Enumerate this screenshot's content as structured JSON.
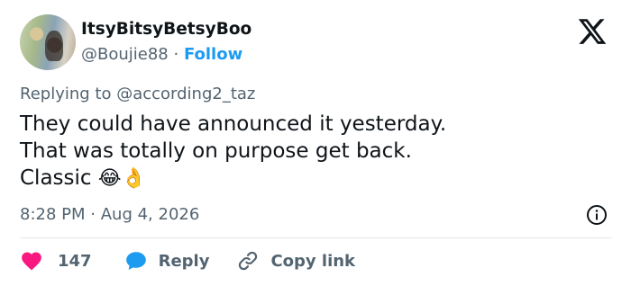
{
  "tweet": {
    "author_name": "ItsyBitsyBetsyBoo",
    "handle": "@Boujie88",
    "separator": "·",
    "follow_label": "Follow",
    "replying_to": "Replying to @according2_taz",
    "lines": [
      "They could have announced it yesterday.",
      "That was totally on purpose get back.",
      "Classic"
    ],
    "emojis": [
      "😂",
      "👌"
    ],
    "time": "8:28 PM",
    "date": "Aug 4, 2026",
    "likes": "147",
    "reply_label": "Reply",
    "copy_link_label": "Copy link"
  },
  "icons": {
    "logo": "x-logo-icon",
    "info": "info-icon",
    "like": "heart-icon",
    "reply": "chat-bubble-icon",
    "copy": "link-icon"
  },
  "colors": {
    "link": "#1d9bf0",
    "muted": "#536471",
    "heart": "#f91880",
    "reply_bubble": "#1d9bf0"
  }
}
